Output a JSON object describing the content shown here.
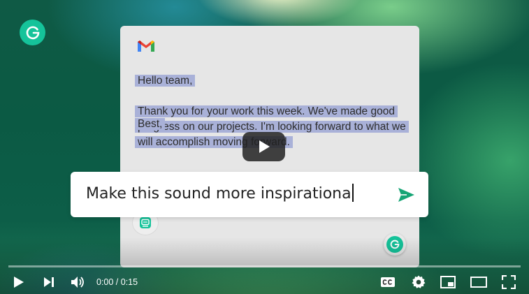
{
  "colors": {
    "grammarly_green": "#15c39a",
    "highlight": "#a9b1d8",
    "send_arrow": "#15a575",
    "player_overlay": "#212121"
  },
  "email": {
    "icon": "gmail-icon",
    "greeting": "Hello team,",
    "body": "Thank you for your work this week. We've made good progress on our projects. I'm looking forward to what we will accomplish moving forward.",
    "sign_off_partial": "Best,"
  },
  "prompt": {
    "text": "Make this sound more inspirationa",
    "send_icon": "send-arrow-icon"
  },
  "player": {
    "time_display": "0:00 / 0:15",
    "progress": 0,
    "icons": [
      "play-icon",
      "next-icon",
      "volume-icon",
      "captions-icon",
      "settings-icon",
      "miniplayer-icon",
      "theater-icon",
      "fullscreen-icon"
    ]
  }
}
